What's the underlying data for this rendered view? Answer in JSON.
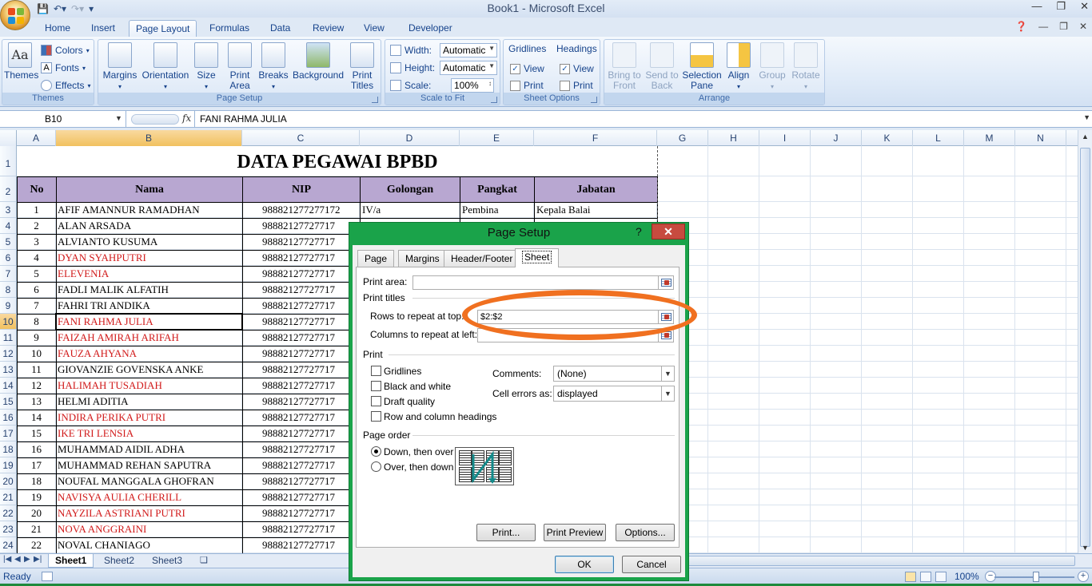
{
  "window": {
    "title": "Book1 - Microsoft Excel"
  },
  "ribbon_tabs": [
    "Home",
    "Insert",
    "Page Layout",
    "Formulas",
    "Data",
    "Review",
    "View",
    "Developer"
  ],
  "ribbon": {
    "themes": {
      "themes_label": "Themes",
      "colors": "Colors",
      "fonts": "Fonts",
      "effects": "Effects",
      "group": "Themes"
    },
    "page_setup": {
      "margins": "Margins",
      "orientation": "Orientation",
      "size": "Size",
      "print_area": "Print Area",
      "breaks": "Breaks",
      "background": "Background",
      "print_titles": "Print Titles",
      "group": "Page Setup"
    },
    "scale_to_fit": {
      "width_label": "Width:",
      "width_value": "Automatic",
      "height_label": "Height:",
      "height_value": "Automatic",
      "scale_label": "Scale:",
      "scale_value": "100%",
      "group": "Scale to Fit"
    },
    "sheet_options": {
      "gridlines": "Gridlines",
      "headings": "Headings",
      "view": "View",
      "print": "Print",
      "group": "Sheet Options"
    },
    "arrange": {
      "bring_to_front": "Bring to Front",
      "send_to_back": "Send to Back",
      "selection_pane": "Selection Pane",
      "align": "Align",
      "group_btn": "Group",
      "rotate": "Rotate",
      "group": "Arrange"
    }
  },
  "formula_bar": {
    "name_box": "B10",
    "fx": "fx",
    "content": "FANI RAHMA JULIA"
  },
  "columns": [
    "A",
    "B",
    "C",
    "D",
    "E",
    "F",
    "G",
    "H",
    "I",
    "J",
    "K",
    "L",
    "M",
    "N"
  ],
  "rows": [
    "1",
    "2",
    "3",
    "4",
    "5",
    "6",
    "7",
    "8",
    "9",
    "10",
    "11",
    "12",
    "13",
    "14",
    "15",
    "16",
    "17",
    "18",
    "19",
    "20",
    "21",
    "22",
    "23",
    "24"
  ],
  "sheet": {
    "title": "DATA PEGAWAI BPBD",
    "headers": [
      "No",
      "Nama",
      "NIP",
      "Golongan",
      "Pangkat",
      "Jabatan"
    ],
    "first_row": {
      "golongan": "IV/a",
      "pangkat": "Pembina",
      "jabatan": "Kepala Balai"
    },
    "nip_full": "988821277277172",
    "nip_clipped": "98882127727717",
    "employees": [
      {
        "no": "1",
        "nama": "AFIF AMANNUR RAMADHAN",
        "red": false
      },
      {
        "no": "2",
        "nama": "ALAN ARSADA",
        "red": false
      },
      {
        "no": "3",
        "nama": "ALVIANTO KUSUMA",
        "red": false
      },
      {
        "no": "4",
        "nama": "DYAN SYAHPUTRI",
        "red": true
      },
      {
        "no": "5",
        "nama": "ELEVENIA",
        "red": true
      },
      {
        "no": "6",
        "nama": "FADLI MALIK ALFATIH",
        "red": false
      },
      {
        "no": "7",
        "nama": "FAHRI TRI ANDIKA",
        "red": false
      },
      {
        "no": "8",
        "nama": "FANI RAHMA JULIA",
        "red": true
      },
      {
        "no": "9",
        "nama": "FAIZAH AMIRAH ARIFAH",
        "red": true
      },
      {
        "no": "10",
        "nama": "FAUZA AHYANA",
        "red": true
      },
      {
        "no": "11",
        "nama": "GIOVANZIE GOVENSKA ANKE",
        "red": false
      },
      {
        "no": "12",
        "nama": "HALIMAH TUSADIAH",
        "red": true
      },
      {
        "no": "13",
        "nama": "HELMI ADITIA",
        "red": false
      },
      {
        "no": "14",
        "nama": "INDIRA PERIKA PUTRI",
        "red": true
      },
      {
        "no": "15",
        "nama": "IKE TRI LENSIA",
        "red": true
      },
      {
        "no": "16",
        "nama": "MUHAMMAD AIDIL ADHA",
        "red": false
      },
      {
        "no": "17",
        "nama": "MUHAMMAD REHAN SAPUTRA",
        "red": false
      },
      {
        "no": "18",
        "nama": "NOUFAL MANGGALA GHOFRAN",
        "red": false
      },
      {
        "no": "19",
        "nama": "NAVISYA AULIA CHERILL",
        "red": true
      },
      {
        "no": "20",
        "nama": "NAYZILA ASTRIANI PUTRI",
        "red": true
      },
      {
        "no": "21",
        "nama": "NOVA ANGGRAINI",
        "red": true
      },
      {
        "no": "22",
        "nama": "NOVAL CHANIAGO",
        "red": false
      }
    ]
  },
  "sheet_tabs": [
    "Sheet1",
    "Sheet2",
    "Sheet3"
  ],
  "status": {
    "text": "Ready",
    "zoom": "100%"
  },
  "dialog": {
    "title": "Page Setup",
    "help": "?",
    "close": "✕",
    "tabs": [
      "Page",
      "Margins",
      "Header/Footer",
      "Sheet"
    ],
    "print_area_label": "Print area:",
    "print_area_value": "",
    "print_titles_label": "Print titles",
    "rows_repeat_label": "Rows to repeat at top:",
    "rows_repeat_value": "$2:$2",
    "cols_repeat_label": "Columns to repeat at left:",
    "cols_repeat_value": "",
    "print_label": "Print",
    "gridlines": "Gridlines",
    "black_white": "Black and white",
    "draft": "Draft quality",
    "row_col_headings": "Row and column headings",
    "comments_label": "Comments:",
    "comments_value": "(None)",
    "cell_errors_label": "Cell errors as:",
    "cell_errors_value": "displayed",
    "page_order_label": "Page order",
    "down_then_over": "Down, then over",
    "over_then_down": "Over, then down",
    "print_btn": "Print...",
    "preview_btn": "Print Preview",
    "options_btn": "Options...",
    "ok": "OK",
    "cancel": "Cancel"
  },
  "colors": {
    "header_fill": "#b8a7d1",
    "red_text": "#d11a1a",
    "dialog_frame": "#1aa34a",
    "highlight": "#f07020"
  }
}
